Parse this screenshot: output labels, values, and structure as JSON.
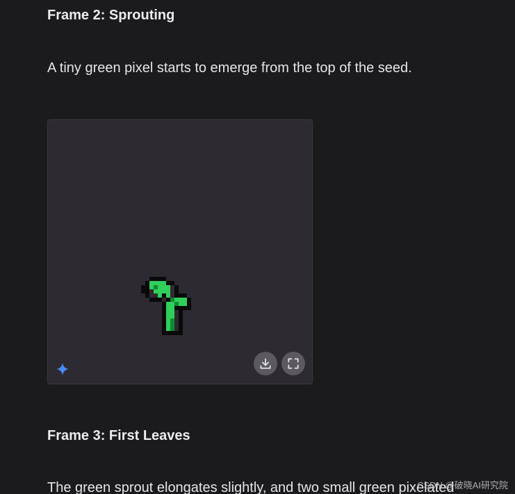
{
  "content": {
    "frame2": {
      "heading": "Frame 2: Sprouting",
      "description": "A tiny green pixel starts to emerge from the top of the seed."
    },
    "frame3": {
      "heading": "Frame 3: First Leaves",
      "description": "The green sprout elongates slightly, and two small green pixelated"
    }
  },
  "image": {
    "badge_icon": "sparkle-icon",
    "actions": [
      {
        "icon": "download-icon"
      },
      {
        "icon": "fullscreen-icon"
      }
    ]
  },
  "watermark": "CSDN @破晓AI研究院",
  "colors": {
    "background": "#1b1b1d",
    "card": "#2d2a31",
    "sprout_green": "#2fcf5a",
    "sprout_dark": "#0f6b2a",
    "sparkle_blue": "#4a8cf7",
    "button": "#5c5a60"
  }
}
